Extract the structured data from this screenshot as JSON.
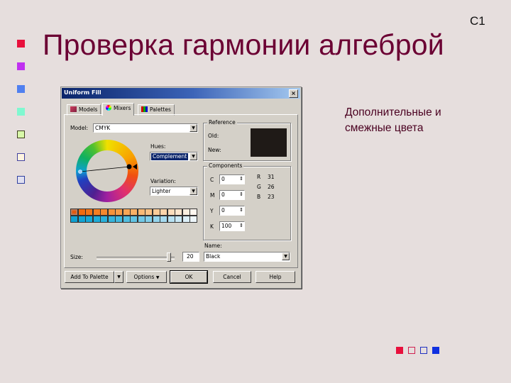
{
  "slide": {
    "number": "C1",
    "title": "Проверка гармонии алгеброй",
    "side_text_line1": "Дополнительные  и",
    "side_text_line2": "смежные цвета",
    "bullets": [
      {
        "fill": "#e8103c",
        "border": "#e8103c"
      },
      {
        "fill": "#c030f0",
        "border": "#c030f0"
      },
      {
        "fill": "#5080f0",
        "border": "#5080f0"
      },
      {
        "fill": "#80f8d0",
        "border": "#80f8d0"
      },
      {
        "fill": "#d8f8a8",
        "border": "#404020"
      },
      {
        "fill": "#fff4e0",
        "border": "#4040a0"
      },
      {
        "fill": "#e0e0f0",
        "border": "#3040a0"
      }
    ],
    "nav_squares": [
      {
        "name": "nav-first",
        "fill": "#e8103c",
        "border": "#e8103c"
      },
      {
        "name": "nav-prev",
        "fill": "transparent",
        "border": "#d02050"
      },
      {
        "name": "nav-next",
        "fill": "transparent",
        "border": "#2030c0"
      },
      {
        "name": "nav-last",
        "fill": "#1030e0",
        "border": "#1030e0"
      }
    ]
  },
  "dialog": {
    "title": "Uniform Fill",
    "close": "×",
    "tabs": [
      {
        "label": "Models",
        "icon": "models-icon"
      },
      {
        "label": "Mixers",
        "icon": "mixers-icon",
        "active": true
      },
      {
        "label": "Palettes",
        "icon": "palettes-icon"
      }
    ],
    "model_label": "Model:",
    "model_value": "CMYK",
    "hues_label": "Hues:",
    "hues_value": "Complement",
    "variation_label": "Variation:",
    "variation_value": "Lighter",
    "reference": {
      "label": "Reference",
      "old_label": "Old:",
      "new_label": "New:",
      "old_color": "#1f1a17",
      "new_color": "#1f1a17"
    },
    "components": {
      "label": "Components",
      "c_label": "C",
      "c_value": "0",
      "m_label": "M",
      "m_value": "0",
      "y_label": "Y",
      "y_value": "0",
      "k_label": "K",
      "k_value": "100",
      "r_label": "R",
      "r_value": "31",
      "g_label": "G",
      "g_value": "26",
      "b_label": "B",
      "b_value": "23"
    },
    "swatches_row1": [
      "#e05a10",
      "#f06a10",
      "#f27418",
      "#f47e22",
      "#f5882e",
      "#f6923a",
      "#f79c48",
      "#f8a656",
      "#f9b066",
      "#fab976",
      "#fbc286",
      "#fccb98",
      "#fdd4aa",
      "#fdddbc",
      "#fee6ce",
      "#fef0e0",
      "#fff7f0"
    ],
    "swatches_row2": [
      "#10a0d0",
      "#12a4d4",
      "#18a8d6",
      "#20acd8",
      "#2ab0da",
      "#36b4dc",
      "#44b9de",
      "#52bee0",
      "#62c3e3",
      "#72c8e6",
      "#82cee9",
      "#94d4ec",
      "#a6daef",
      "#b8e1f2",
      "#cae8f5",
      "#dceff8",
      "#eef6fb"
    ],
    "size_label": "Size:",
    "size_value": "20",
    "size_fraction": 0.95,
    "name_label": "Name:",
    "name_value": "Black",
    "buttons": {
      "add_to_palette": "Add To Palette",
      "options": "Options",
      "ok": "OK",
      "cancel": "Cancel",
      "help": "Help"
    }
  }
}
